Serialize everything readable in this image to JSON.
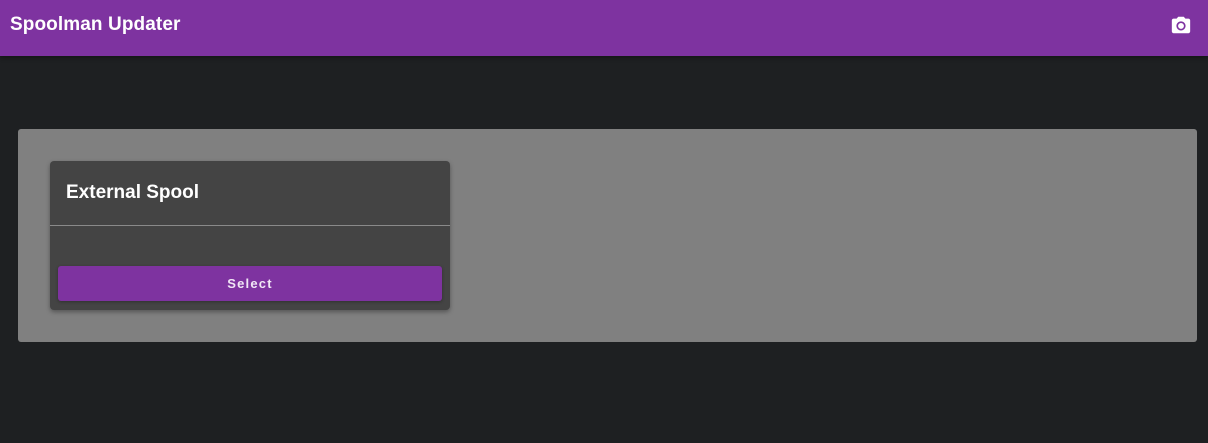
{
  "app_bar": {
    "title": "Spoolman Updater",
    "action_icon": "camera-icon",
    "color": "#7e33a0"
  },
  "main": {
    "cards": [
      {
        "title": "External Spool",
        "button_label": "Select"
      }
    ]
  },
  "colors": {
    "background": "#1e2022",
    "panel": "#808080",
    "card": "#444444",
    "accent": "#7e33a0"
  }
}
